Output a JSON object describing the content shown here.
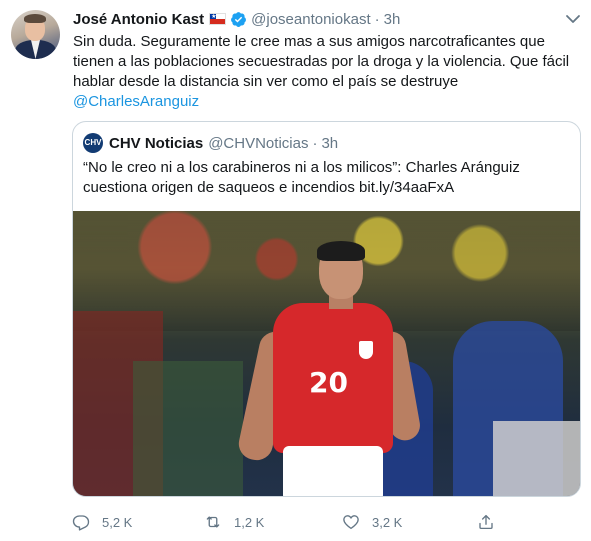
{
  "author": {
    "name": "José Antonio Kast",
    "handle": "@joseantoniokast",
    "time": "3h",
    "dot": "·"
  },
  "tweet": {
    "text": "Sin duda. Seguramente le cree mas a sus amigos narcotraficantes que\ntienen a las poblaciones secuestradas por la droga y la violencia. Que fácil\nhablar desde la distancia sin ver como el país se destruye",
    "mention": "@CharlesAranguiz"
  },
  "quoted": {
    "logo_text": "CHV",
    "name": "CHV Noticias",
    "handle": "@CHVNoticias",
    "dot": "·",
    "time": "3h",
    "text": "“No le creo ni a los carabineros ni a los milicos”: Charles Aránguiz\ncuestiona origen de saqueos e incendios bit.ly/34aaFxA",
    "media": {
      "jersey_number": "20"
    }
  },
  "actions": {
    "reply_count": "5,2 K",
    "retweet_count": "1,2 K",
    "like_count": "3,2 K"
  },
  "colors": {
    "link": "#1b95e0",
    "secondary_text": "#657786",
    "border": "#ccd6dd",
    "verified": "#1da1f2"
  },
  "icons": [
    "chile-flag-icon",
    "verified-badge-icon",
    "more-options-chevron-icon",
    "reply-icon",
    "retweet-icon",
    "like-icon",
    "share-icon"
  ]
}
